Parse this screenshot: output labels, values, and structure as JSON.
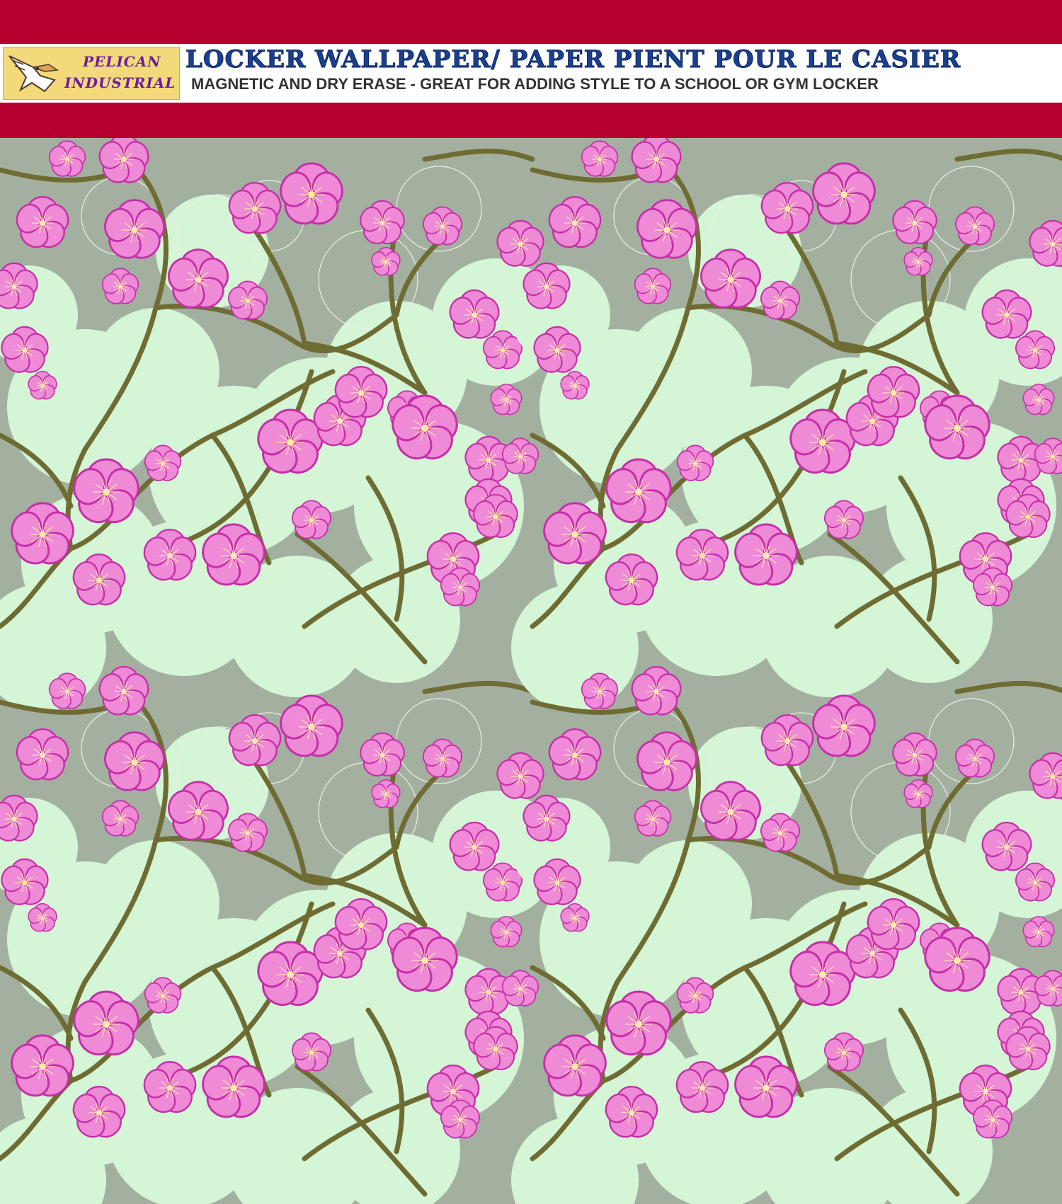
{
  "header": {
    "logo_line1": "PELICAN",
    "logo_line2": "INDUSTRIAL",
    "title": "LOCKER WALLPAPER/ PAPER PIENT POUR LE CASIER",
    "subtitle": "MAGNETIC AND DRY ERASE - GREAT FOR ADDING STYLE TO A SCHOOL OR GYM LOCKER"
  },
  "colors": {
    "band": "#b5002f",
    "background": "#a3b0a0",
    "cloud": "#d4f6d6",
    "petal": "#ef8ad6",
    "petal_edge": "#c52ea8",
    "stamen": "#ffe8b0",
    "branch": "#6f6c33",
    "title": "#1b3f8f"
  },
  "pattern": {
    "motif": "cherry-blossom",
    "tile_columns": 2,
    "tile_rows": 2
  }
}
